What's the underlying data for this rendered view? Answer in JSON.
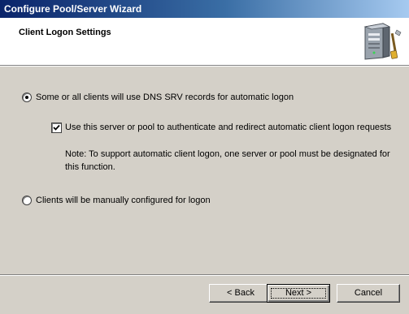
{
  "window": {
    "title": "Configure Pool/Server Wizard"
  },
  "header": {
    "heading": "Client Logon Settings",
    "graphic_icon": "server-tools-icon"
  },
  "options": {
    "dns_srv": {
      "label": "Some or all clients will use DNS SRV records for automatic logon",
      "selected": true
    },
    "authenticate_checkbox": {
      "label": "Use this server or pool to authenticate and redirect automatic client logon requests",
      "checked": true
    },
    "note": "Note: To support automatic client logon, one server or pool must be designated for this function.",
    "manual": {
      "label": "Clients will be manually configured for logon",
      "selected": false
    }
  },
  "buttons": {
    "back": "< Back",
    "next": "Next >",
    "cancel": "Cancel"
  }
}
